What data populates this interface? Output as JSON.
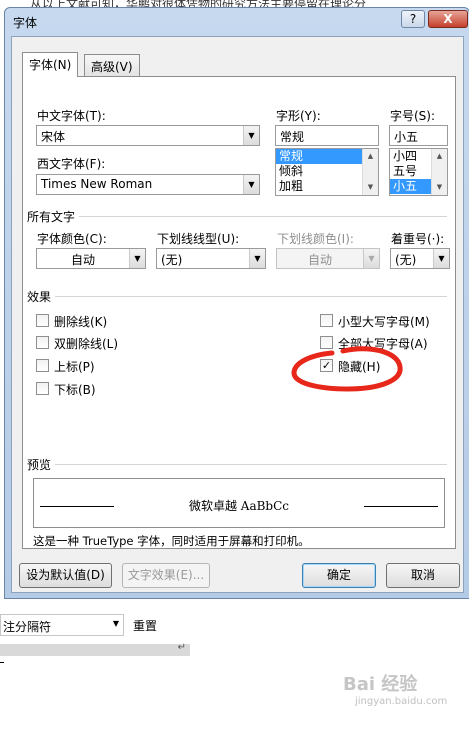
{
  "background": {
    "doc_text": "从以上文献可知，华鹏对很体凭物的研究方法主要停留在理论分"
  },
  "dialog": {
    "title": "字体",
    "help_glyph": "?",
    "close_glyph": "X",
    "tabs": [
      {
        "label": "字体(N)"
      },
      {
        "label": "高级(V)"
      }
    ],
    "chinese_font": {
      "label": "中文字体(T):",
      "value": "宋体"
    },
    "western_font": {
      "label": "西文字体(F):",
      "value": "Times New Roman"
    },
    "style": {
      "label": "字形(Y):",
      "value": "常规",
      "options": [
        "常规",
        "倾斜",
        "加粗"
      ],
      "selected": 0
    },
    "size": {
      "label": "字号(S):",
      "value": "小五",
      "options": [
        "小四",
        "五号",
        "小五"
      ],
      "selected": 2
    },
    "all_text": {
      "heading": "所有文字",
      "font_color": {
        "label": "字体颜色(C):",
        "value": "自动"
      },
      "underline_style": {
        "label": "下划线线型(U):",
        "value": "(无)"
      },
      "underline_color": {
        "label": "下划线颜色(I):",
        "value": "自动"
      },
      "emphasis": {
        "label": "着重号(·):",
        "value": "(无)"
      }
    },
    "effects": {
      "heading": "效果",
      "items": [
        {
          "label": "删除线(K)",
          "checked": false
        },
        {
          "label": "双删除线(L)",
          "checked": false
        },
        {
          "label": "上标(P)",
          "checked": false
        },
        {
          "label": "下标(B)",
          "checked": false
        },
        {
          "label": "小型大写字母(M)",
          "checked": false
        },
        {
          "label": "全部大写字母(A)",
          "checked": false
        },
        {
          "label": "隐藏(H)",
          "checked": true
        }
      ]
    },
    "preview": {
      "heading": "预览",
      "sample": "微软卓越 AaBbCc",
      "note": "这是一种 TrueType 字体，同时适用于屏幕和打印机。"
    },
    "buttons": {
      "set_default": "设为默认值(D)",
      "text_effects": "文字效果(E)...",
      "ok": "确定",
      "cancel": "取消"
    }
  },
  "below": {
    "style_value": "注分隔符",
    "reset_label": "重置"
  },
  "watermark": {
    "text": "Bai 经验",
    "url": "jingyan.baidu.com"
  },
  "colors": {
    "selection": "#3399ff",
    "annotation": "#e8271b"
  }
}
